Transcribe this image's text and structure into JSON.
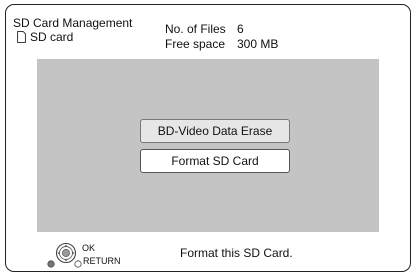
{
  "header": {
    "title": "SD Card Management",
    "device_label": "SD card",
    "device_icon": "sd-card-icon",
    "files_label": "No. of Files",
    "files_value": "6",
    "space_label": "Free space",
    "space_value": "300 MB"
  },
  "menu": {
    "items": [
      {
        "label": "BD-Video Data Erase",
        "selected": false
      },
      {
        "label": "Format SD Card",
        "selected": true
      }
    ]
  },
  "footer": {
    "ok_label": "OK",
    "return_label": "RETURN",
    "remote_icon": "remote-dpad-icon",
    "message": "Format this SD Card."
  },
  "colors": {
    "panel_background": "#c4c4c4",
    "selected_item": "#ffffff",
    "unselected_item": "#e6e6e6",
    "frame_border": "#222222"
  }
}
